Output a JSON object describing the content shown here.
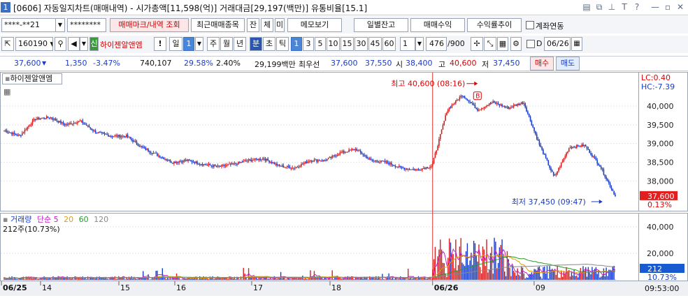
{
  "window": {
    "number": "1",
    "title": "[0606] 자동일지차트(매매내역) - 시가총액[11,598(억)] 거래대금[29,197(백만)] 유통비율[15.1]",
    "icons": [
      "window-tile-icon",
      "window-copy-icon",
      "pin-icon",
      "text-size-icon",
      "help-icon",
      "minimize-icon",
      "maximize-icon",
      "close-icon"
    ],
    "icon_glyphs": [
      "▤",
      "⧉",
      "⊥",
      "T",
      "?",
      "—",
      "▫",
      "✕"
    ]
  },
  "toolbar1": {
    "account": "****-**21",
    "password": "********",
    "trade_mark_btn": "매매마크/내역 조회",
    "recent_btn": "최근매매종목",
    "balance_btn": "잔",
    "fill_btn": "체",
    "unfilled_btn": "미",
    "memo_btn": "메모보기",
    "daily_balance_btn": "일별잔고",
    "trade_profit_btn": "매매수익",
    "return_trend_btn": "수익률추이",
    "account_link_label": "계좌연동"
  },
  "toolbar2": {
    "code": "160190",
    "code_arrow": "▼",
    "credit_badge": "신",
    "stock_name": "하이젠알앤엠",
    "alert": "!",
    "period_selected": "일",
    "period_count": "1",
    "periods": [
      "주",
      "월",
      "년"
    ],
    "minute_label": "분",
    "second_label": "초",
    "tick_label": "틱",
    "minute_options": [
      "1",
      "3",
      "5",
      "10",
      "15",
      "30",
      "45",
      "60"
    ],
    "minute_selected": "1",
    "count_input": "1",
    "range": "476",
    "range_total": "/900",
    "date_prefix": "D",
    "date": "06/26"
  },
  "quote": {
    "price": "37,600",
    "change": "1,350",
    "change_pct": "-3.47%",
    "volume": "740,107",
    "turnover_pct": "29.58%",
    "ratio": "2.40%",
    "amount": "29,199백만",
    "best_label": "최우선",
    "ask": "37,600",
    "bid": "37,550",
    "open_label": "시",
    "open": "38,400",
    "high_label": "고",
    "high": "40,600",
    "low_label": "저",
    "low": "37,450",
    "buy_btn": "매수",
    "sell_btn": "매도"
  },
  "chart": {
    "stock_label": "하이젠알앤엠",
    "lc": "LC:0.40",
    "hc": "HC:-7.39",
    "price_ticks": [
      "40,000",
      "39,500",
      "39,000",
      "38,500",
      "38,000"
    ],
    "current_price": "37,600",
    "current_pct": "0.13%",
    "high_annotation": "최고 40,600 (08:16)",
    "low_annotation": "최저 37,450 (09:47)",
    "buy_marker": "B",
    "volume_legend": {
      "title": "거래량",
      "ma_label": "단순",
      "ma5": "5",
      "ma20": "20",
      "ma60": "60",
      "ma120": "120",
      "value": "212주(10.73%)"
    },
    "volume_ticks": [
      "40,000",
      "20,000"
    ],
    "current_volume": "212",
    "current_volume_pct": "10.73%",
    "x_labels": [
      "06/25",
      "14",
      "15",
      "16",
      "17",
      "18",
      "06/26",
      "09"
    ],
    "time_label": "09:53:00",
    "colors": {
      "up": "#d42020",
      "down": "#1a3cc8",
      "ma5": "#c020c0",
      "ma20": "#e0a000",
      "ma60": "#2a9a2a",
      "ma120": "#888888",
      "price_box": "#e02020",
      "volume_box": "#1a5ad0"
    }
  },
  "chart_data": {
    "type": "candlestick",
    "title": "하이젠알앤엠",
    "x_labels": [
      "06/25",
      "14",
      "15",
      "16",
      "17",
      "18",
      "06/26",
      "09"
    ],
    "price_ylim": [
      37300,
      40800
    ],
    "close_anchors": [
      [
        "06/25 open",
        39350
      ],
      [
        "",
        39200
      ],
      [
        "",
        39650
      ],
      [
        "",
        39700
      ],
      [
        "",
        39500
      ],
      [
        "",
        39600
      ],
      [
        "",
        39300
      ],
      [
        "",
        39200
      ],
      [
        "",
        39200
      ],
      [
        "",
        38900
      ],
      [
        "",
        38700
      ],
      [
        "",
        38500
      ],
      [
        "",
        38550
      ],
      [
        "",
        38450
      ],
      [
        "",
        38380
      ],
      [
        "",
        38450
      ],
      [
        "",
        38550
      ],
      [
        "",
        38600
      ],
      [
        "",
        38400
      ],
      [
        "",
        38350
      ],
      [
        "",
        38550
      ],
      [
        "",
        38550
      ],
      [
        "",
        38750
      ],
      [
        "",
        38850
      ],
      [
        "",
        38550
      ],
      [
        "",
        38500
      ],
      [
        "",
        38350
      ],
      [
        "",
        38300
      ],
      [
        "06/26 open",
        38400
      ],
      [
        "",
        39900
      ],
      [
        "",
        40300
      ],
      [
        "",
        39900
      ],
      [
        "",
        40100
      ],
      [
        "",
        39950
      ],
      [
        "",
        40100
      ],
      [
        "",
        39000
      ],
      [
        "",
        38100
      ],
      [
        "",
        38900
      ],
      [
        "",
        38950
      ],
      [
        "",
        38400
      ],
      [
        "09:53",
        37600
      ]
    ],
    "high": 40600,
    "low": 37450,
    "volume_ylim": [
      0,
      48000
    ],
    "last_volume": 212
  }
}
